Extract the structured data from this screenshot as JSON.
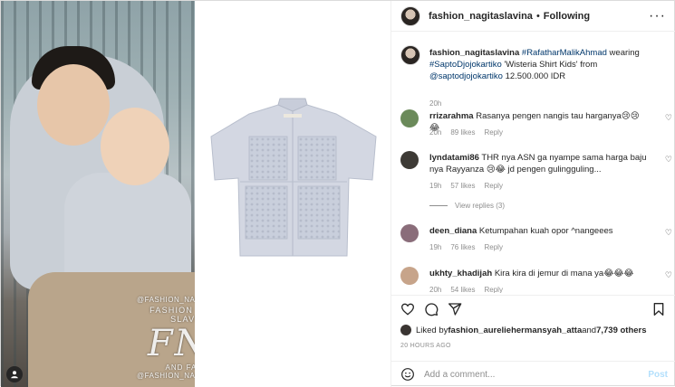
{
  "media": {
    "watermark_top": "@FASHION_NAGITASLAVINA",
    "watermark_name": "FASHION NAGITA SLAVINA",
    "watermark_logo": "FNS",
    "watermark_family": "AND FAMILY",
    "watermark_bottom": "@FASHION_NAGITASLAVINA"
  },
  "header": {
    "username": "fashion_nagitaslavina",
    "separator": "•",
    "follow_status": "Following",
    "more": "···"
  },
  "caption": {
    "username": "fashion_nagitaslavina",
    "tag1": "#RafatharMalikAhmad",
    "text1": " wearing ",
    "tag2": "#SaptoDjojokartiko",
    "text2": " 'Wisteria Shirt Kids' from ",
    "mention": "@saptodjojokartiko",
    "text3": " 12.500.000 IDR",
    "time": "20h"
  },
  "comments": [
    {
      "username": "rrizarahma",
      "text": "Rasanya pengen nangis tau harganya😢😢😂",
      "time": "20h",
      "likes": "89 likes",
      "reply": "Reply",
      "avatar_color": "#6b8a5a"
    },
    {
      "username": "lyndatami86",
      "text": "THR nya ASN ga nyampe sama harga baju nya Rayyanza 😢😂 jd pengen gulingguling...",
      "time": "19h",
      "likes": "57 likes",
      "reply": "Reply",
      "avatar_color": "#3d3a35",
      "view_replies": "View replies (3)"
    },
    {
      "username": "deen_diana",
      "text": "Ketumpahan kuah opor ^nangeees",
      "time": "19h",
      "likes": "76 likes",
      "reply": "Reply",
      "avatar_color": "#8a6d7a"
    },
    {
      "username": "ukhty_khadijah",
      "text": "Kira kira di jemur di mana ya😂😂😂",
      "time": "20h",
      "likes": "54 likes",
      "reply": "Reply",
      "avatar_color": "#c7a48a"
    }
  ],
  "likes": {
    "prefix": "Liked by ",
    "user": "fashion_aureliehermansyah_atta",
    "middle": " and ",
    "count": "7,739 others"
  },
  "posted": "20 HOURS AGO",
  "add_comment": {
    "placeholder": "Add a comment...",
    "post_label": "Post"
  }
}
